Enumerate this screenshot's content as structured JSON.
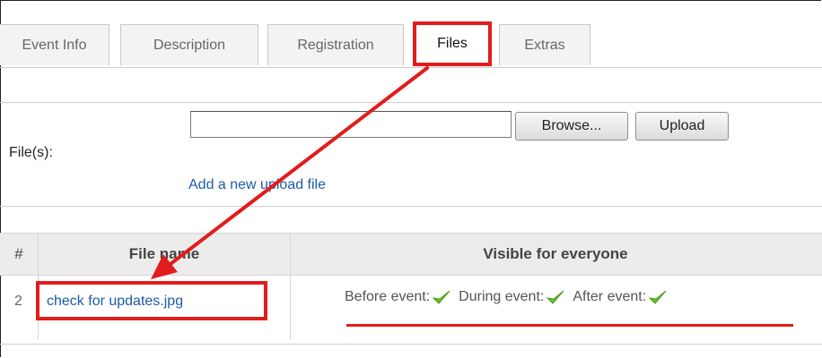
{
  "tabs": [
    {
      "label": "Event Info"
    },
    {
      "label": "Description"
    },
    {
      "label": "Registration"
    },
    {
      "label": "Files"
    },
    {
      "label": "Extras"
    }
  ],
  "upload": {
    "label": "File(s):",
    "input_value": "",
    "browse_label": "Browse...",
    "upload_label": "Upload",
    "add_link": "Add a new upload file"
  },
  "table": {
    "headers": [
      "#",
      "File name",
      "Visible for everyone"
    ],
    "rows": [
      {
        "index": "2",
        "file_name": "check for updates.jpg",
        "before": "Before event:",
        "during": "During event:",
        "after": "After event:"
      }
    ]
  },
  "colors": {
    "annotation": "#e21c1c",
    "link": "#1e5aa8",
    "check": "#6bbf2a"
  }
}
